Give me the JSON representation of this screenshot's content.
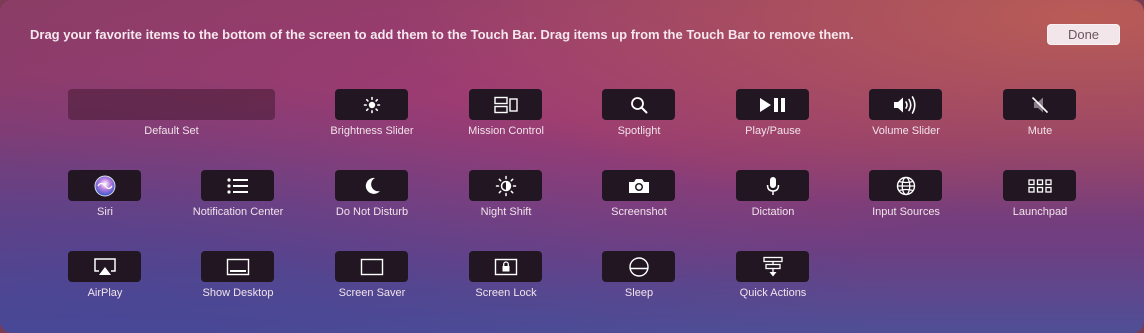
{
  "header": {
    "instruction": "Drag your favorite items to the bottom of the screen to add them to the Touch Bar. Drag items up from the Touch Bar to remove them.",
    "done_label": "Done"
  },
  "items": {
    "default_set": {
      "label": "Default Set"
    },
    "brightness": {
      "label": "Brightness Slider",
      "icon": "sun-icon"
    },
    "mission_control": {
      "label": "Mission Control",
      "icon": "mission-control-icon"
    },
    "spotlight": {
      "label": "Spotlight",
      "icon": "magnifier-icon"
    },
    "play_pause": {
      "label": "Play/Pause",
      "icon": "play-pause-icon"
    },
    "volume": {
      "label": "Volume Slider",
      "icon": "speaker-icon"
    },
    "mute": {
      "label": "Mute",
      "icon": "speaker-muted-icon"
    },
    "siri": {
      "label": "Siri",
      "icon": "siri-icon"
    },
    "notification_center": {
      "label": "Notification Center",
      "icon": "list-icon"
    },
    "do_not_disturb": {
      "label": "Do Not Disturb",
      "icon": "moon-icon"
    },
    "night_shift": {
      "label": "Night Shift",
      "icon": "night-shift-icon"
    },
    "screenshot": {
      "label": "Screenshot",
      "icon": "camera-icon"
    },
    "dictation": {
      "label": "Dictation",
      "icon": "microphone-icon"
    },
    "input_sources": {
      "label": "Input Sources",
      "icon": "globe-icon"
    },
    "launchpad": {
      "label": "Launchpad",
      "icon": "grid-icon"
    },
    "airplay": {
      "label": "AirPlay",
      "icon": "airplay-icon"
    },
    "show_desktop": {
      "label": "Show Desktop",
      "icon": "desktop-icon"
    },
    "screen_saver": {
      "label": "Screen Saver",
      "icon": "screen-icon"
    },
    "screen_lock": {
      "label": "Screen Lock",
      "icon": "lock-screen-icon"
    },
    "sleep": {
      "label": "Sleep",
      "icon": "sleep-icon"
    },
    "quick_actions": {
      "label": "Quick Actions",
      "icon": "quick-actions-icon"
    }
  }
}
